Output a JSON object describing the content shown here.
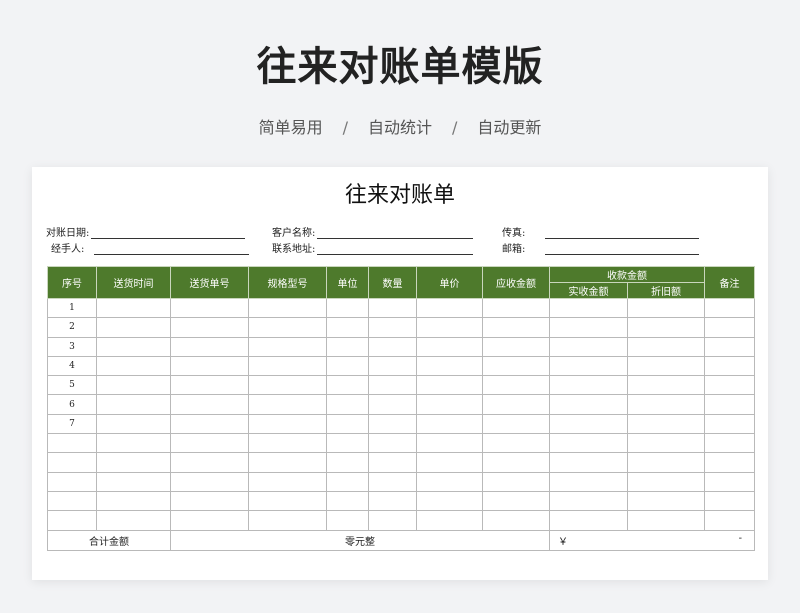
{
  "header": {
    "title": "往来对账单模版",
    "tags": [
      "简单易用",
      "自动统计",
      "自动更新"
    ],
    "separator": "/"
  },
  "document": {
    "title": "往来对账单",
    "fields": {
      "statement_date": "对账日期:",
      "customer_name": "客户名称:",
      "fax": "传真:",
      "handler": "经手人:",
      "address": "联系地址:",
      "email": "邮箱:"
    },
    "columns": {
      "no": "序号",
      "delivery_time": "送货时间",
      "delivery_no": "送货单号",
      "spec": "规格型号",
      "unit": "单位",
      "qty": "数量",
      "price": "单价",
      "receivable": "应收金额",
      "received_group": "收款金额",
      "actual_received": "实收金额",
      "depreciation": "折旧额",
      "remarks": "备注"
    },
    "rows": [
      {
        "no": "1"
      },
      {
        "no": "2"
      },
      {
        "no": "3"
      },
      {
        "no": "4"
      },
      {
        "no": "5"
      },
      {
        "no": "6"
      },
      {
        "no": "7"
      },
      {
        "no": ""
      },
      {
        "no": ""
      },
      {
        "no": ""
      },
      {
        "no": ""
      },
      {
        "no": ""
      }
    ],
    "total": {
      "label": "合计金额",
      "amount_words": "零元整",
      "currency": "￥",
      "amount": "-"
    }
  },
  "colors": {
    "header_green": "#4e7a2c",
    "page_background": "#f2f3f5"
  }
}
